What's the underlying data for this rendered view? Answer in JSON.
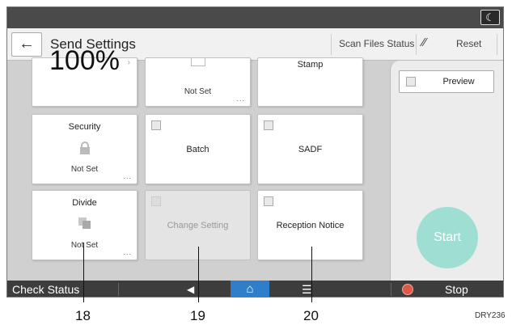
{
  "header": {
    "back_icon": "arrow-left-icon",
    "title": "Send Settings",
    "scan_status_label": "Scan Files Status",
    "reset_icon": "reset-slash-icon",
    "reset_label": "Reset"
  },
  "statusbar": {
    "moon_icon": "moon-icon",
    "moon_glyph": "☾"
  },
  "tiles": {
    "ratio": {
      "value": "100%"
    },
    "middle_top": {
      "sub": "Not Set",
      "dots": "..."
    },
    "stamp": {
      "title": "Stamp"
    },
    "security": {
      "title": "Security",
      "sub": "Not Set",
      "dots": "...",
      "icon": "lock-icon"
    },
    "batch": {
      "label": "Batch"
    },
    "sadf": {
      "label": "SADF"
    },
    "divide": {
      "title": "Divide",
      "sub": "Not Set",
      "dots": "...",
      "icon": "divide-icon"
    },
    "change_setting": {
      "label": "Change Setting"
    },
    "reception_notice": {
      "label": "Reception Notice"
    }
  },
  "right_panel": {
    "preview_label": "Preview",
    "start_label": "Start"
  },
  "bottom_bar": {
    "check_status_label": "Check Status",
    "back_glyph": "◀",
    "home_glyph": "⌂",
    "menu_glyph": "☰",
    "stop_label": "Stop"
  },
  "callouts": {
    "c18": "18",
    "c19": "19",
    "c20": "20"
  },
  "figure_code": "DRY236",
  "colors": {
    "start": "#9fdfd3",
    "home": "#2f7ec9",
    "stop_icon": "#e05a4a"
  }
}
